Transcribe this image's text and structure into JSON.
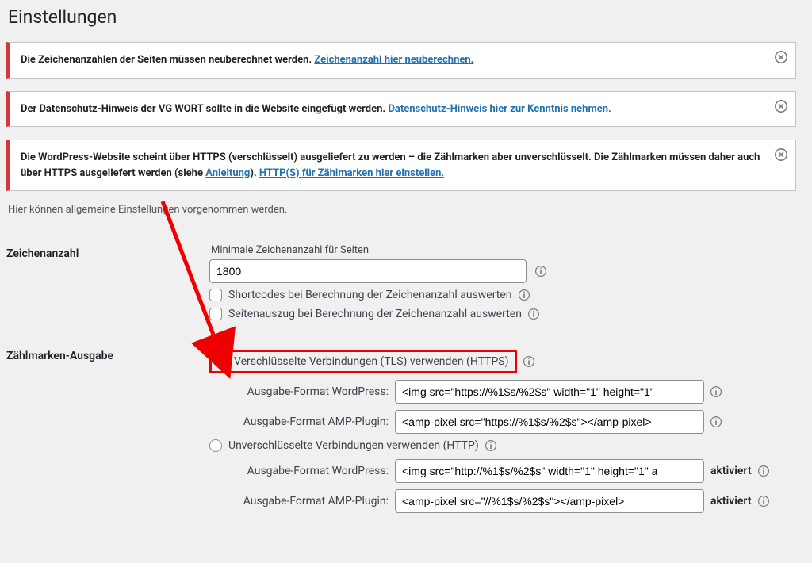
{
  "page_title": "Einstellungen",
  "notices": {
    "n1_text": "Die Zeichenanzahlen der Seiten müssen neuberechnet werden. ",
    "n1_link": "Zeichenanzahl hier neuberechnen.",
    "n2_text": "Der Datenschutz-Hinweis der VG WORT sollte in die Website eingefügt werden. ",
    "n2_link": "Datenschutz-Hinweis hier zur Kenntnis nehmen.",
    "n3_a": "Die WordPress-Website scheint über HTTPS (verschlüsselt) ausgeliefert zu werden – die Zählmarken aber unverschlüsselt. Die Zählmarken müssen daher auch über HTTPS ausgeliefert werden (siehe ",
    "n3_link1": "Anleitung",
    "n3_b": "). ",
    "n3_link2": "HTTP(S) für Zählmarken hier einstellen."
  },
  "description": "Hier können allgemeine Einstellungen vorgenommen werden.",
  "section_chars": {
    "heading": "Zeichenanzahl",
    "min_label": "Minimale Zeichenanzahl für Seiten",
    "min_value": "1800",
    "chk1": "Shortcodes bei Berechnung der Zeichenanzahl auswerten",
    "chk2": "Seitenauszug bei Berechnung der Zeichenanzahl auswerten"
  },
  "section_output": {
    "heading": "Zählmarken-Ausgabe",
    "radio_https": "Verschlüsselte Verbindungen (TLS) verwenden (HTTPS)",
    "fmt_wp_label": "Ausgabe-Format WordPress:",
    "fmt_wp_https": "<img src=\"https://%1$s/%2$s\" width=\"1\" height=\"1\"",
    "fmt_amp_label": "Ausgabe-Format AMP-Plugin:",
    "fmt_amp_https": "<amp-pixel src=\"https://%1$s/%2$s\"></amp-pixel>",
    "radio_http": "Unverschlüsselte Verbindungen verwenden (HTTP)",
    "fmt_wp_http": "<img src=\"http://%1$s/%2$s\" width=\"1\" height=\"1\" a",
    "fmt_amp_http": "<amp-pixel src=\"//%1$s/%2$s\"></amp-pixel>",
    "status_active": "aktiviert"
  }
}
